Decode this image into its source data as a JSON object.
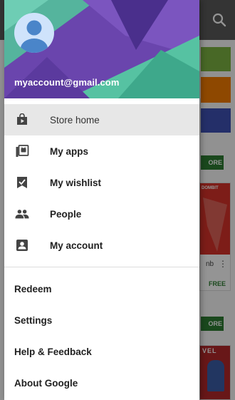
{
  "account": {
    "email": "myaccount@gmail.com"
  },
  "nav": {
    "items": [
      {
        "label": "Store home",
        "icon": "store-home-icon",
        "active": true
      },
      {
        "label": "My apps",
        "icon": "my-apps-icon",
        "active": false
      },
      {
        "label": "My wishlist",
        "icon": "wishlist-icon",
        "active": false
      },
      {
        "label": "People",
        "icon": "people-icon",
        "active": false
      },
      {
        "label": "My account",
        "icon": "account-icon",
        "active": false
      }
    ]
  },
  "links": [
    {
      "label": "Redeem"
    },
    {
      "label": "Settings"
    },
    {
      "label": "Help & Feedback"
    },
    {
      "label": "About Google"
    }
  ],
  "background": {
    "pill_label": "ORE",
    "card_tag": "DOMBIT",
    "card_name": "nb",
    "card_price": "FREE",
    "hero_label": "VEL"
  },
  "colors": {
    "header_purple": "#6a45ad",
    "header_teal": "#4fc6a5",
    "active_item_bg": "#e7e7e7",
    "avatar_bg": "#cfe3fb",
    "avatar_fg": "#4a85c9"
  }
}
